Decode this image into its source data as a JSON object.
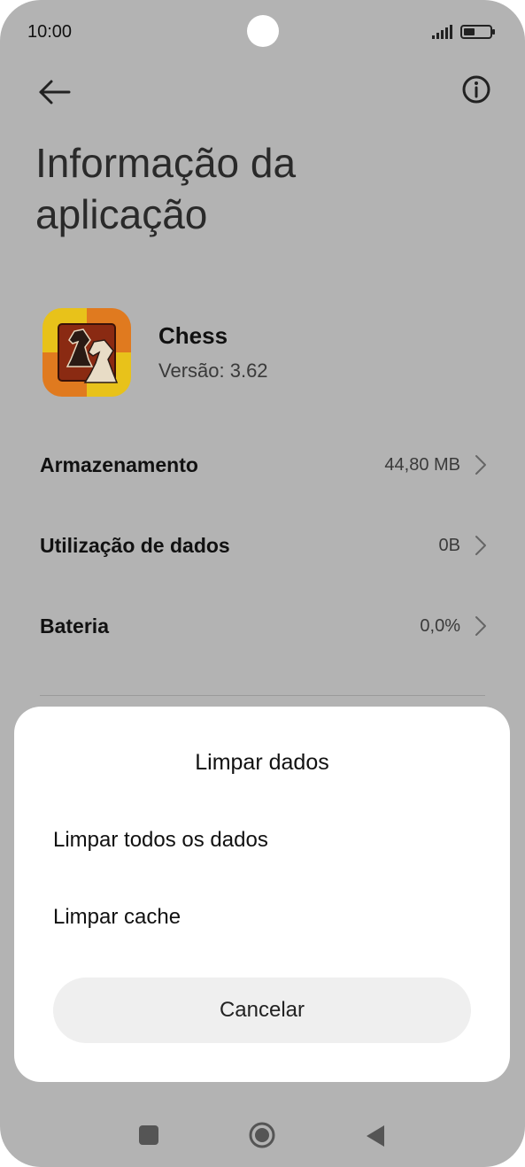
{
  "status_bar": {
    "time": "10:00"
  },
  "header": {
    "back_icon": "arrow-left-icon",
    "info_icon": "info-circle-icon",
    "title": "Informação da aplicação"
  },
  "app": {
    "name": "Chess",
    "version": "Versão: 3.62",
    "icon": "chess-knights-app-icon"
  },
  "settings": [
    {
      "label": "Armazenamento",
      "value": "44,80 MB"
    },
    {
      "label": "Utilização de dados",
      "value": "0B"
    },
    {
      "label": "Bateria",
      "value": "0,0%"
    }
  ],
  "dialog": {
    "title": "Limpar dados",
    "options": [
      "Limpar todos os dados",
      "Limpar cache"
    ],
    "cancel_label": "Cancelar"
  },
  "nav_bar": {
    "recents_icon": "square-icon",
    "home_icon": "circle-home-icon",
    "back_icon": "triangle-back-icon"
  },
  "colors": {
    "scrim_background": "#b3b3b3",
    "sheet_background": "#ffffff",
    "cancel_button": "#efefef",
    "icon_orange": "#e07a1f",
    "icon_yellow": "#e8c21a"
  }
}
